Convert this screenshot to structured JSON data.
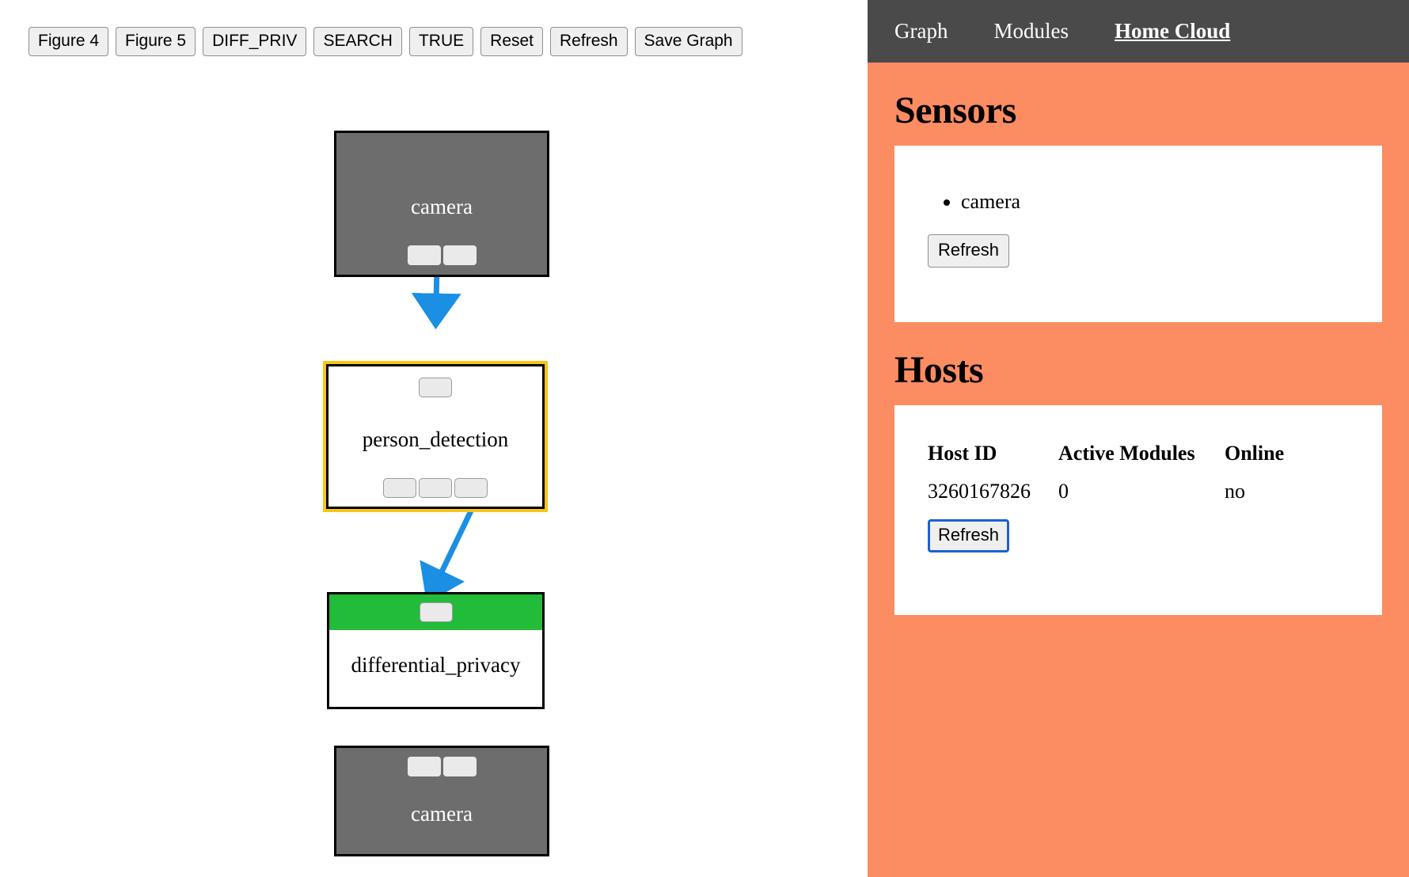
{
  "toolbar": {
    "buttons": [
      {
        "label": "Figure 4",
        "name": "figure-4-button"
      },
      {
        "label": "Figure 5",
        "name": "figure-5-button"
      },
      {
        "label": "DIFF_PRIV",
        "name": "diff-priv-button"
      },
      {
        "label": "SEARCH",
        "name": "search-button"
      },
      {
        "label": "TRUE",
        "name": "true-button"
      },
      {
        "label": "Reset",
        "name": "reset-button"
      },
      {
        "label": "Refresh",
        "name": "refresh-button"
      },
      {
        "label": "Save Graph",
        "name": "save-graph-button"
      }
    ]
  },
  "graph": {
    "nodes": [
      {
        "id": "camera-top",
        "label": "camera",
        "type": "sensor",
        "selected": false
      },
      {
        "id": "person-detection",
        "label": "person_detection",
        "type": "module",
        "selected": true
      },
      {
        "id": "differential-privacy",
        "label": "differential_privacy",
        "type": "module",
        "selected": false
      },
      {
        "id": "camera-bottom",
        "label": "camera",
        "type": "sensor",
        "selected": false
      }
    ],
    "edges": [
      {
        "from": "camera-top",
        "to": "person-detection"
      },
      {
        "from": "person-detection",
        "to": "differential-privacy"
      }
    ],
    "colors": {
      "sensor_fill": "#6d6d6d",
      "module_fill": "#ffffff",
      "selection_ring": "#f5c518",
      "module_header": "#22bb3a",
      "edge": "#1a8fe3"
    }
  },
  "cloud": {
    "nav": {
      "items": [
        {
          "label": "Graph",
          "active": false
        },
        {
          "label": "Modules",
          "active": false
        },
        {
          "label": "Home Cloud",
          "active": true
        }
      ]
    },
    "accent_color": "#fc8c62",
    "sensors": {
      "title": "Sensors",
      "items": [
        "camera"
      ],
      "refresh_label": "Refresh"
    },
    "hosts": {
      "title": "Hosts",
      "columns": [
        "Host ID",
        "Active Modules",
        "Online"
      ],
      "rows": [
        {
          "host_id": "3260167826",
          "active_modules": "0",
          "online": "no"
        }
      ],
      "refresh_label": "Refresh"
    }
  }
}
